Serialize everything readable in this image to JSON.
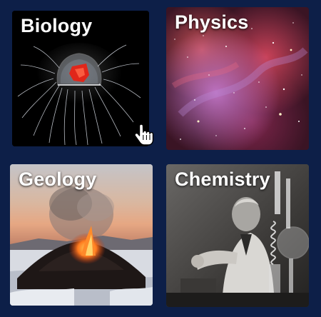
{
  "tiles": {
    "biology": {
      "label": "Biology"
    },
    "physics": {
      "label": "Physics"
    },
    "geology": {
      "label": "Geology"
    },
    "chemistry": {
      "label": "Chemistry"
    }
  },
  "colors": {
    "background": "#0d1f48",
    "label_text": "#ffffff"
  },
  "icons": {
    "cursor": "hand-pointer-icon"
  }
}
